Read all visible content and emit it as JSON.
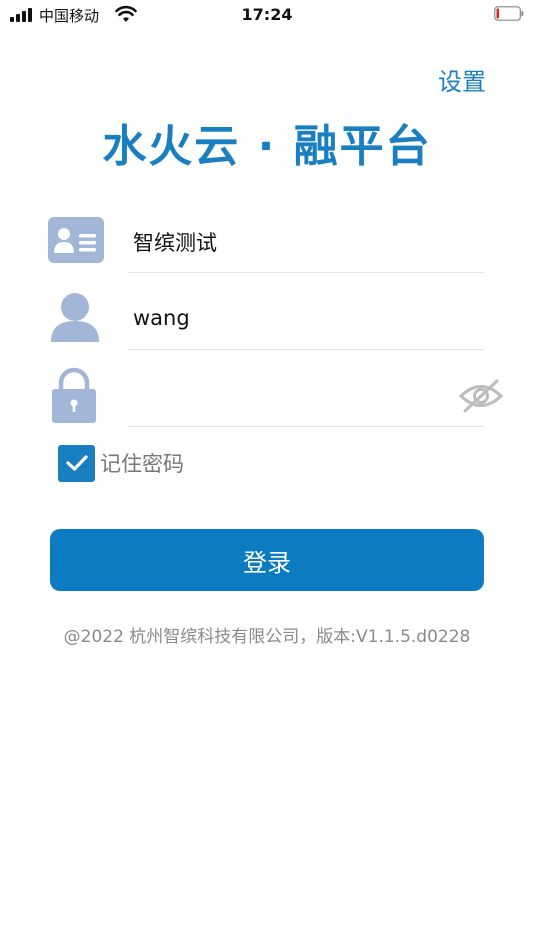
{
  "status_bar": {
    "carrier": "中国移动",
    "time": "17:24"
  },
  "header": {
    "settings_label": "设置",
    "title": "水火云 · 融平台"
  },
  "form": {
    "company": {
      "value": "智缤测试",
      "icon": "id-card-icon"
    },
    "username": {
      "value": "wang",
      "icon": "user-icon"
    },
    "password": {
      "value": "",
      "icon": "lock-icon",
      "toggle_icon": "eye-off-icon"
    },
    "remember": {
      "label": "记住密码",
      "checked": true
    }
  },
  "login_button": {
    "label": "登录"
  },
  "footer": {
    "text": "@2022 杭州智缤科技有限公司，版本:V1.1.5.d0228"
  },
  "colors": {
    "accent": "#1a7fc1",
    "button": "#0c7cc2",
    "icon": "#a2b6d8",
    "footer_text": "#8a8a8a"
  }
}
